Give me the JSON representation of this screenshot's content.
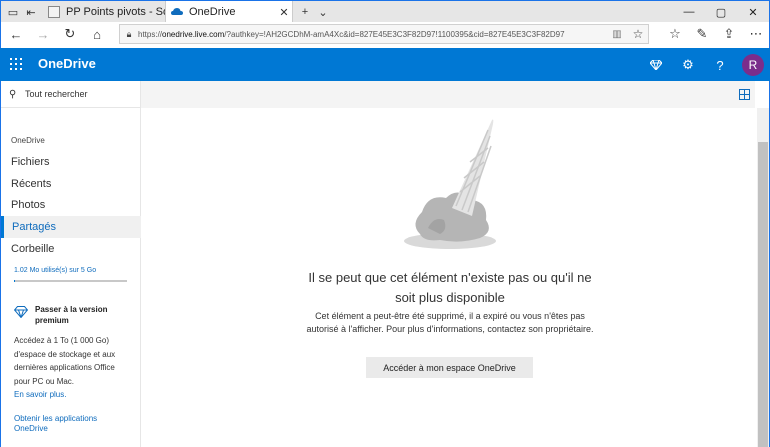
{
  "browser": {
    "tabs": [
      {
        "label": "PP Points pivots - Solution s",
        "active": false
      },
      {
        "label": "OneDrive",
        "active": true
      }
    ],
    "url_prefix": "https://",
    "url_domain": "onedrive.live.com",
    "url_rest": "/?authkey=!AH2GCDhM-amA4Xc&id=827E45E3C3F82D97!1100395&cid=827E45E3C3F82D97",
    "icons": [
      "tab-manager-icon",
      "back-tab-icon",
      "close-icon",
      "new-tab-icon",
      "chevron-down-icon",
      "back-icon",
      "forward-icon",
      "refresh-icon",
      "home-icon",
      "lock-icon",
      "reader-icon",
      "star-icon",
      "minimize-icon",
      "maximize-icon",
      "close-window-icon",
      "favorites-icon",
      "pen-icon",
      "share-icon",
      "more-icon"
    ]
  },
  "header": {
    "brand": "OneDrive",
    "avatar_initial": "R",
    "color": "#0078d4"
  },
  "sidebar": {
    "search_placeholder": "Tout rechercher",
    "section_label": "OneDrive",
    "items": [
      {
        "label": "Fichiers",
        "selected": false
      },
      {
        "label": "Récents",
        "selected": false
      },
      {
        "label": "Photos",
        "selected": false
      },
      {
        "label": "Partagés",
        "selected": true
      },
      {
        "label": "Corbeille",
        "selected": false
      }
    ],
    "quota_text": "1.02 Mo utilisé(s) sur 5 Go",
    "quota_fraction": 0.0002,
    "premium_title": "Passer à la version premium",
    "premium_body": "Accédez à 1 To (1 000 Go) d'espace de stockage et aux dernières applications Office pour PC ou Mac.",
    "premium_link": "En savoir plus.",
    "get_apps": "Obtenir les applications OneDrive"
  },
  "main": {
    "title": "Il se peut que cet élément n'existe pas ou qu'il ne soit plus disponible",
    "body": "Cet élément a peut-être été supprimé, il a expiré ou vous n'êtes pas autorisé à l'afficher. Pour plus d'informations, contactez son propriétaire.",
    "cta": "Accéder à mon espace OneDrive"
  }
}
